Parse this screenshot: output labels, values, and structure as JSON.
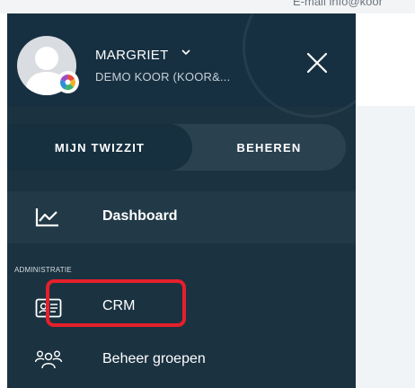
{
  "browser": {
    "top_text": "E-mail   info@koor"
  },
  "sidebar": {
    "user": {
      "name": "MARGRIET",
      "org": "DEMO KOOR (KOOR&..."
    },
    "tabs": [
      {
        "label": "MIJN TWIZZIT",
        "active": true
      },
      {
        "label": "BEHEREN",
        "active": false
      }
    ],
    "dashboard_label": "Dashboard",
    "section_label": "ADMINISTRATIE",
    "items": [
      {
        "label": "CRM",
        "icon": "id-card-icon"
      },
      {
        "label": "Beheer groepen",
        "icon": "group-icon"
      }
    ]
  },
  "colors": {
    "sidebar_bg": "#1b3241",
    "highlight": "#e5202b"
  }
}
